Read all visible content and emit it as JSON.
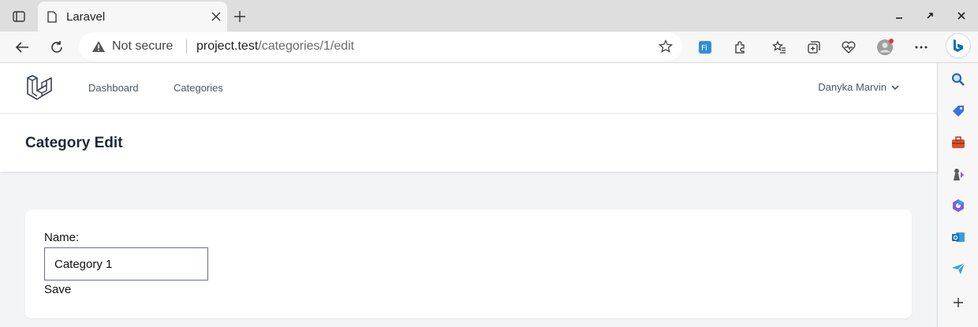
{
  "browser": {
    "tab_title": "Laravel",
    "security_label": "Not secure",
    "url_host": "project.test",
    "url_path": "/categories/1/edit"
  },
  "app": {
    "nav_items": [
      "Dashboard",
      "Categories"
    ],
    "user_name": "Danyka Marvin",
    "page_title": "Category Edit"
  },
  "form": {
    "name_label": "Name:",
    "name_value": "Category 1",
    "save_label": "Save"
  },
  "colors": {
    "accent": "#0f6cbd",
    "page_bg": "#f3f4f6"
  }
}
